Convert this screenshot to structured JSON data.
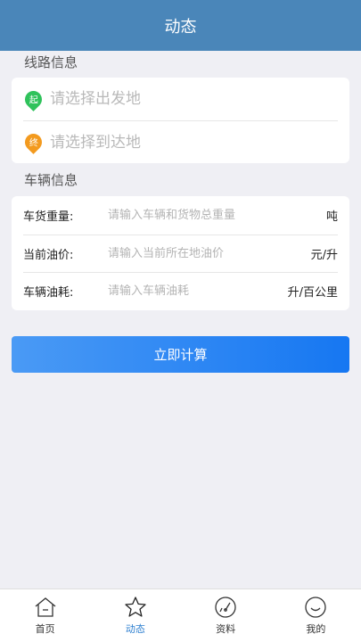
{
  "header": {
    "title": "动态"
  },
  "route": {
    "section_label": "线路信息",
    "start_badge": "起",
    "end_badge": "终",
    "start_placeholder": "请选择出发地",
    "end_placeholder": "请选择到达地"
  },
  "vehicle": {
    "section_label": "车辆信息",
    "rows": [
      {
        "label": "车货重量:",
        "placeholder": "请输入车辆和货物总重量",
        "unit": "吨"
      },
      {
        "label": "当前油价:",
        "placeholder": "请输入当前所在地油价",
        "unit": "元/升"
      },
      {
        "label": "车辆油耗:",
        "placeholder": "请输入车辆油耗",
        "unit": "升/百公里"
      }
    ]
  },
  "calculate_button": "立即计算",
  "tabbar": {
    "items": [
      {
        "label": "首页",
        "icon": "home-icon"
      },
      {
        "label": "动态",
        "icon": "star-icon",
        "active": true
      },
      {
        "label": "资料",
        "icon": "gauge-icon"
      },
      {
        "label": "我的",
        "icon": "smile-icon"
      }
    ]
  },
  "colors": {
    "header": "#4a86b9",
    "start_pin": "#2fc25b",
    "end_pin": "#f39a1e",
    "button_start": "#4a9af5",
    "button_end": "#1677f2",
    "tab_active": "#2d7fd0"
  }
}
